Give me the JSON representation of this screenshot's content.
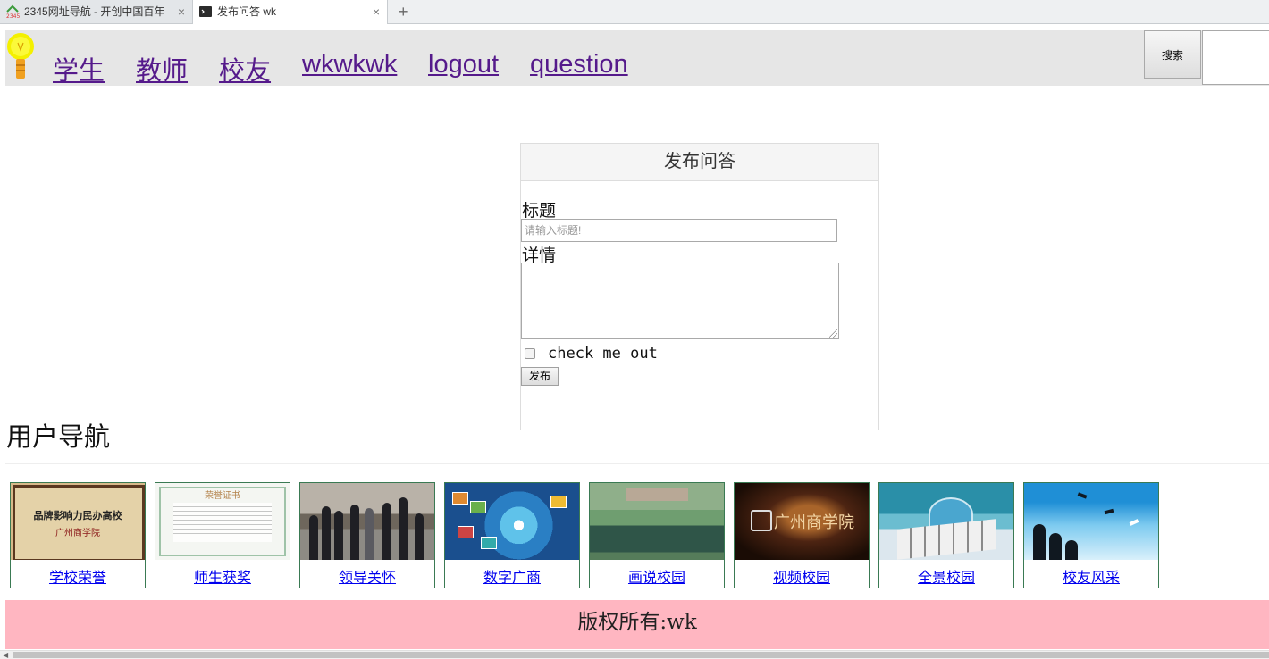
{
  "browser": {
    "tabs": [
      {
        "title": "2345网址导航 - 开创中国百年",
        "active": false
      },
      {
        "title": "发布问答 wk",
        "active": true
      }
    ],
    "new_tab_symbol": "+",
    "close_symbol": "×"
  },
  "navbar": {
    "logo_icon": "lightbulb-icon",
    "links": [
      "学生",
      "教师",
      "校友",
      "wkwkwk",
      "logout",
      "question"
    ],
    "search_button": "搜索",
    "search_value": ""
  },
  "form": {
    "heading": "发布问答",
    "title_label": "标题",
    "title_placeholder": "请输入标题!",
    "detail_label": "详情",
    "checkbox_label": "check me out",
    "submit_label": "发布"
  },
  "user_nav": {
    "heading": "用户导航",
    "cards": [
      {
        "caption": "学校荣誉",
        "image_text_1": "品牌影响力民办高校",
        "image_text_2": "广州商学院"
      },
      {
        "caption": "师生获奖",
        "image_text_1": "荣誉证书"
      },
      {
        "caption": "领导关怀"
      },
      {
        "caption": "数字广商"
      },
      {
        "caption": "画说校园"
      },
      {
        "caption": "视频校园",
        "image_text_1": "广州商学院"
      },
      {
        "caption": "全景校园"
      },
      {
        "caption": "校友风采"
      }
    ]
  },
  "footer": {
    "text": "版权所有:wk",
    "background": "#ffb6c1"
  },
  "colors": {
    "navbar_bg": "#e6e6e6",
    "visited_link": "#551a8b",
    "link": "#0000ee",
    "card_border": "#3a7a53"
  }
}
